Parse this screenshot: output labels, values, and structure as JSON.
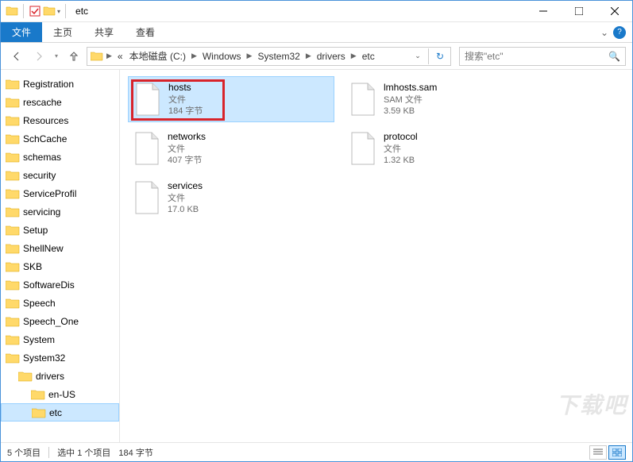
{
  "window": {
    "title": "etc"
  },
  "ribbon": {
    "file": "文件",
    "home": "主页",
    "share": "共享",
    "view": "查看"
  },
  "breadcrumb": {
    "prefix": "«",
    "segments": [
      "本地磁盘 (C:)",
      "Windows",
      "System32",
      "drivers",
      "etc"
    ]
  },
  "search": {
    "placeholder": "搜索\"etc\""
  },
  "tree": {
    "items": [
      {
        "label": "Registration",
        "indent": 0
      },
      {
        "label": "rescache",
        "indent": 0
      },
      {
        "label": "Resources",
        "indent": 0
      },
      {
        "label": "SchCache",
        "indent": 0
      },
      {
        "label": "schemas",
        "indent": 0
      },
      {
        "label": "security",
        "indent": 0
      },
      {
        "label": "ServiceProfil",
        "indent": 0
      },
      {
        "label": "servicing",
        "indent": 0
      },
      {
        "label": "Setup",
        "indent": 0
      },
      {
        "label": "ShellNew",
        "indent": 0
      },
      {
        "label": "SKB",
        "indent": 0
      },
      {
        "label": "SoftwareDis",
        "indent": 0
      },
      {
        "label": "Speech",
        "indent": 0
      },
      {
        "label": "Speech_One",
        "indent": 0
      },
      {
        "label": "System",
        "indent": 0
      },
      {
        "label": "System32",
        "indent": 0
      },
      {
        "label": "drivers",
        "indent": 1
      },
      {
        "label": "en-US",
        "indent": 2
      },
      {
        "label": "etc",
        "indent": 2,
        "selected": true
      }
    ]
  },
  "files": [
    {
      "name": "hosts",
      "type": "文件",
      "size": "184 字节",
      "selected": true,
      "highlighted": true
    },
    {
      "name": "lmhosts.sam",
      "type": "SAM 文件",
      "size": "3.59 KB"
    },
    {
      "name": "networks",
      "type": "文件",
      "size": "407 字节"
    },
    {
      "name": "protocol",
      "type": "文件",
      "size": "1.32 KB"
    },
    {
      "name": "services",
      "type": "文件",
      "size": "17.0 KB"
    }
  ],
  "statusbar": {
    "count": "5 个项目",
    "selection": "选中 1 个项目",
    "size": "184 字节"
  },
  "watermark": "下载吧"
}
